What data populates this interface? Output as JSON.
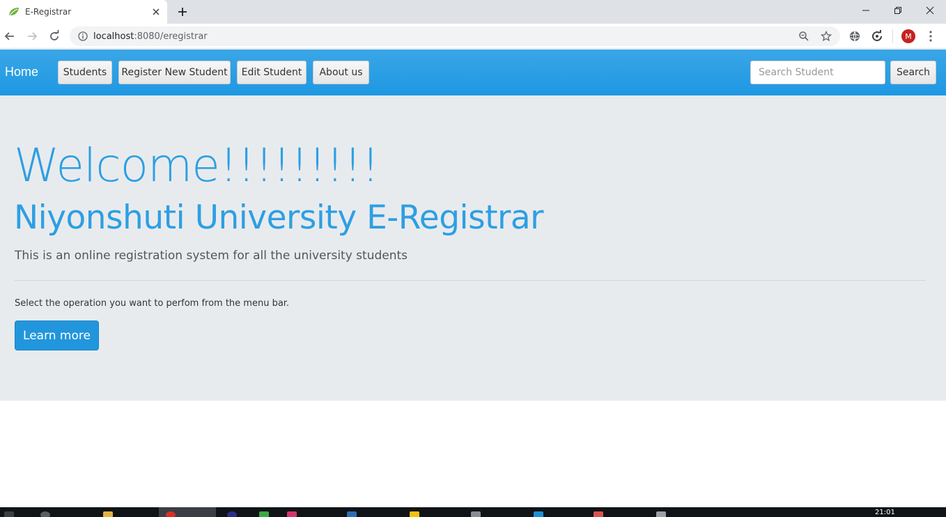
{
  "browser": {
    "tab_title": "E-Registrar",
    "url_host": "localhost",
    "url_path": ":8080/eregistrar",
    "profile_initial": "M"
  },
  "navbar": {
    "brand": "Home",
    "items": [
      {
        "label": "Students"
      },
      {
        "label": "Register New Student"
      },
      {
        "label": "Edit Student"
      },
      {
        "label": "About us"
      }
    ],
    "search_placeholder": "Search Student",
    "search_button": "Search"
  },
  "jumbotron": {
    "heading": "Welcome!!!!!!!!!",
    "subheading": "Niyonshuti University E-Registrar",
    "lead": "This is an online registration system for all the university students",
    "instruction": "Select the operation you want to perfom from the menu bar.",
    "button": "Learn more"
  },
  "taskbar": {
    "time": "21:01"
  },
  "colors": {
    "navbar": "#1e98e3",
    "heading": "#2d9fe2",
    "button": "#2196dd",
    "jumbotron_bg": "#e8ebee"
  }
}
